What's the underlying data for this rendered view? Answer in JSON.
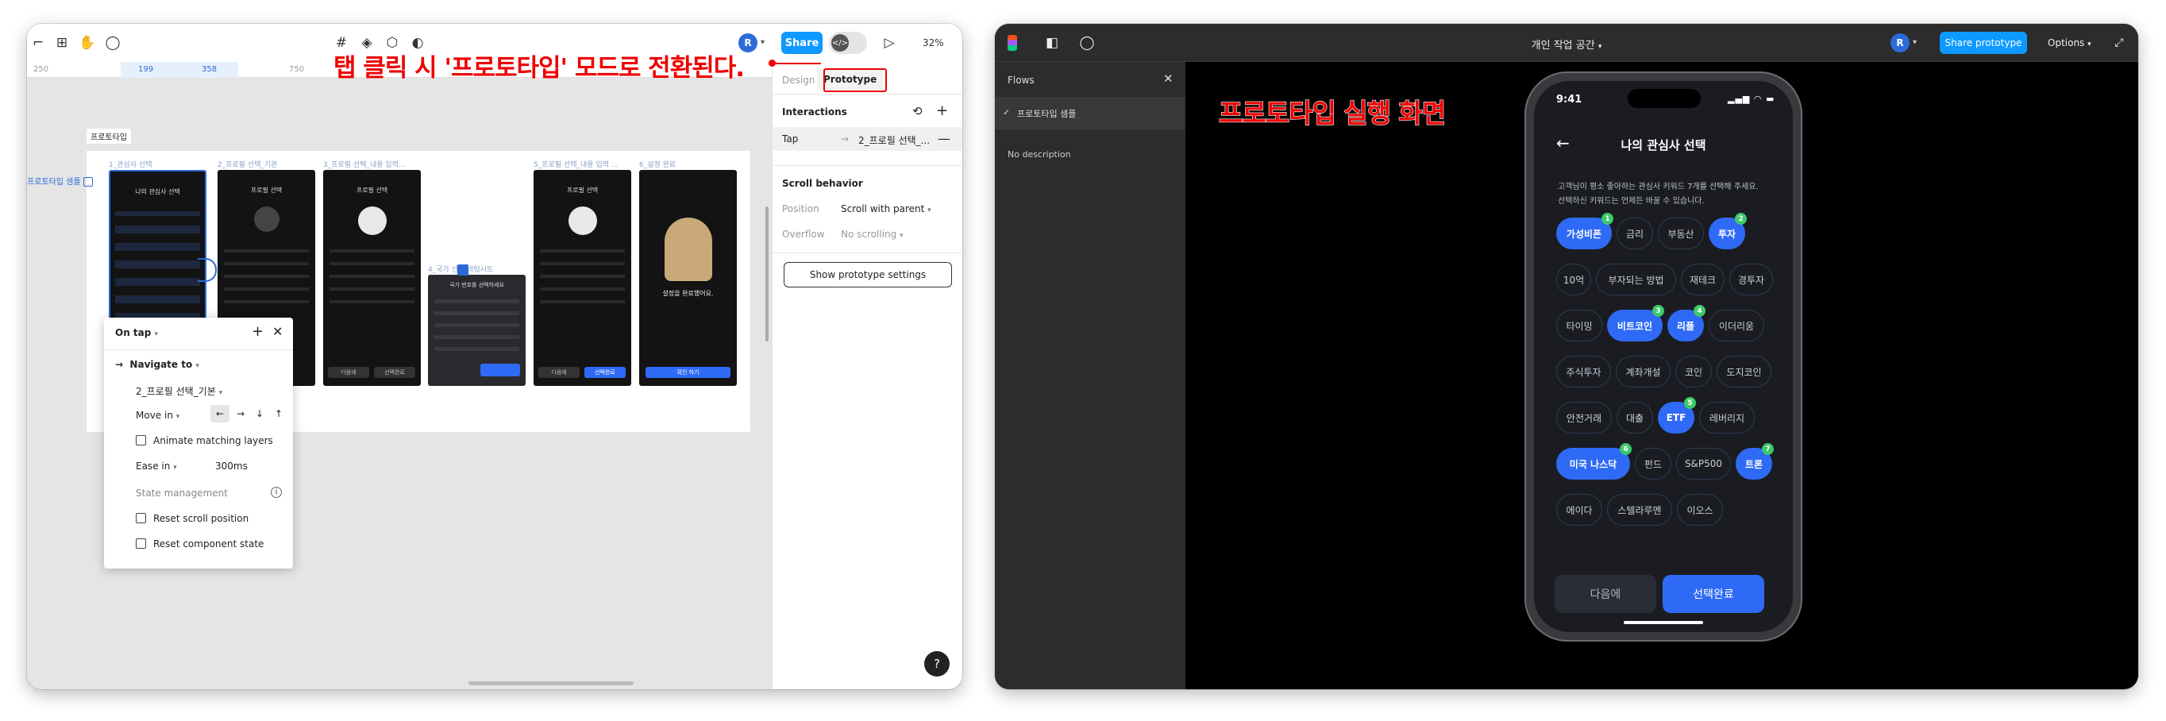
{
  "annotation_left": "탭 클릭 시 '프로토타입' 모드로 전환된다.",
  "annotation_right": "프로토타입 실행 화면",
  "editor": {
    "avatar": "R",
    "share_label": "Share",
    "zoom": "32%",
    "ruler": [
      "250",
      "199",
      "358",
      "750"
    ],
    "tabs": [
      "Design",
      "Prototype"
    ],
    "interactions_label": "Interactions",
    "tap_label": "Tap",
    "tap_target": "2_프로필 선택_...",
    "scroll_behavior": "Scroll behavior",
    "position_label": "Position",
    "position_value": "Scroll with parent",
    "overflow_label": "Overflow",
    "overflow_value": "No scrolling",
    "proto_settings": "Show prototype settings",
    "section_label": "프로토타입",
    "flow_tag": "프로토타입 샘플",
    "frames": [
      "1_관심사 선택",
      "2_프로필 선택_기본",
      "3_프로필 선택_내용 입력...",
      "4_국가 선택 바텀시트",
      "5_프로필 선택_내용 입력 ...",
      "6_설정 완료"
    ],
    "frame_titles": [
      "나의 관심사 선택",
      "프로필 선택",
      "프로필 선택",
      "국가 번호를 선택하세요",
      "프로필 선택",
      "설정을 완료했어요."
    ],
    "frame_btn_left": "다음에",
    "frame_btn_right": "선택완료",
    "frame_btn_done": "확인 하기",
    "tapbox": {
      "header": "On tap",
      "action": "Navigate to",
      "destination": "2_프로필 선택_기본",
      "animation": "Move in",
      "animate_matching": "Animate matching layers",
      "easing": "Ease in",
      "duration": "300ms",
      "state_mgmt": "State management",
      "reset_scroll": "Reset scroll position",
      "reset_component": "Reset component state"
    },
    "help": "?"
  },
  "viewer": {
    "workspace": "개인 작업 공간",
    "avatar": "R",
    "share_prototype": "Share prototype",
    "options": "Options",
    "flows_title": "Flows",
    "flow_item": "프로토타입 샘플",
    "no_description": "No description",
    "phone": {
      "time": "9:41",
      "title": "나의 관심사 선택",
      "desc1": "고객님이 평소 좋아하는 관심사 키워드 7개를 선택해 주세요.",
      "desc2": "선택하신 키워드는 언제든 바꿀 수 있습니다.",
      "rows": [
        [
          {
            "t": "가성비폰",
            "on": true,
            "b": "1"
          },
          {
            "t": "금리"
          },
          {
            "t": "부동산"
          },
          {
            "t": "투자",
            "on": true,
            "b": "2"
          }
        ],
        [
          {
            "t": "10억"
          },
          {
            "t": "부자되는 방법"
          },
          {
            "t": "재테크"
          },
          {
            "t": "경투자"
          }
        ],
        [
          {
            "t": "타이밍"
          },
          {
            "t": "비트코인",
            "on": true,
            "b": "3"
          },
          {
            "t": "리플",
            "on": true,
            "b": "4"
          },
          {
            "t": "이더리움"
          }
        ],
        [
          {
            "t": "주식투자"
          },
          {
            "t": "계좌개설"
          },
          {
            "t": "코인"
          },
          {
            "t": "도지코인"
          }
        ],
        [
          {
            "t": "안전거래"
          },
          {
            "t": "대출"
          },
          {
            "t": "ETF",
            "on": true,
            "b": "5"
          },
          {
            "t": "레버리지"
          }
        ],
        [
          {
            "t": "미국 나스닥",
            "on": true,
            "b": "6"
          },
          {
            "t": "펀드"
          },
          {
            "t": "S&P500"
          },
          {
            "t": "트론",
            "on": true,
            "b": "7"
          }
        ],
        [
          {
            "t": "에이다"
          },
          {
            "t": "스텔라루멘"
          },
          {
            "t": "이오스"
          }
        ]
      ],
      "btn_later": "다음에",
      "btn_done": "선택완료"
    }
  }
}
